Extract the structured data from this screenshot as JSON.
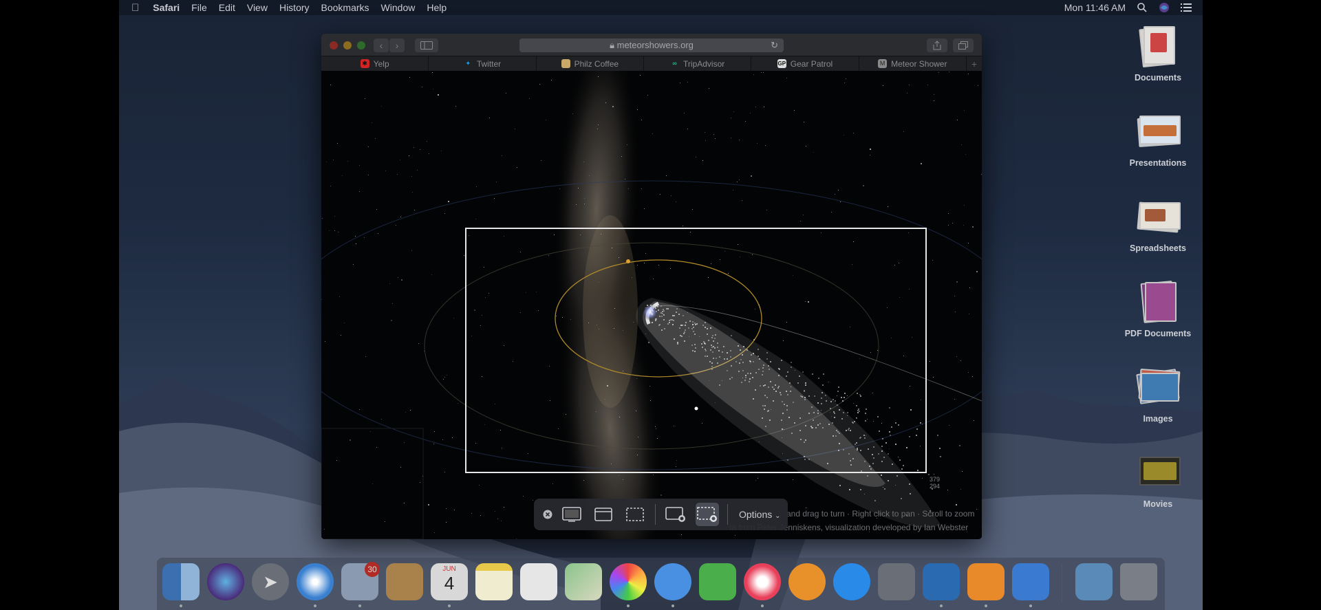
{
  "menubar": {
    "apple_icon": "apple-icon",
    "app_name": "Safari",
    "items": [
      "File",
      "Edit",
      "View",
      "History",
      "Bookmarks",
      "Window",
      "Help"
    ],
    "clock": "Mon 11:46 AM",
    "status_icons": [
      "spotlight-search-icon",
      "siri-icon",
      "notification-center-icon"
    ]
  },
  "browser": {
    "address": "meteorshowers.org",
    "tabs": [
      {
        "label": "Yelp",
        "favicon": "yelp-icon",
        "color": "#d32323"
      },
      {
        "label": "Twitter",
        "favicon": "twitter-icon",
        "color": "#1da1f2"
      },
      {
        "label": "Philz Coffee",
        "favicon": "philz-icon",
        "color": "#c8a96a"
      },
      {
        "label": "TripAdvisor",
        "favicon": "tripadvisor-icon",
        "color": "#34e0a1"
      },
      {
        "label": "Gear Patrol",
        "favicon": "gearpatrol-icon",
        "color": "#222222"
      },
      {
        "label": "Meteor Shower",
        "favicon": "meteor-icon",
        "color": "#8a8a8a"
      }
    ],
    "page_hints": {
      "line1": "and drag to turn · Right click to pan · Scroll to zoom",
      "line2": "ta from Peter Jenniskens, visualization developed by Ian Webster"
    },
    "size_label": [
      "379",
      "294"
    ]
  },
  "capture_toolbar": {
    "options_label": "Options",
    "accent": "#4b4e56"
  },
  "desktop": {
    "stacks": [
      "Documents",
      "Presentations",
      "Spreadsheets",
      "PDF Documents",
      "Images",
      "Movies"
    ]
  },
  "dock": {
    "mail_badge": "30",
    "calendar_month": "JUN",
    "calendar_day": "4",
    "apps": [
      "finder-icon",
      "siri-icon",
      "launchpad-icon",
      "safari-icon",
      "mail-icon",
      "contacts-icon",
      "calendar-icon",
      "notes-icon",
      "reminders-icon",
      "maps-icon",
      "photos-icon",
      "messages-icon",
      "facetime-icon",
      "music-icon",
      "books-icon",
      "app-store-icon",
      "system-preferences-icon",
      "keynote-icon",
      "pages-icon",
      "xcode-icon",
      "downloads-icon",
      "trash-icon"
    ]
  }
}
